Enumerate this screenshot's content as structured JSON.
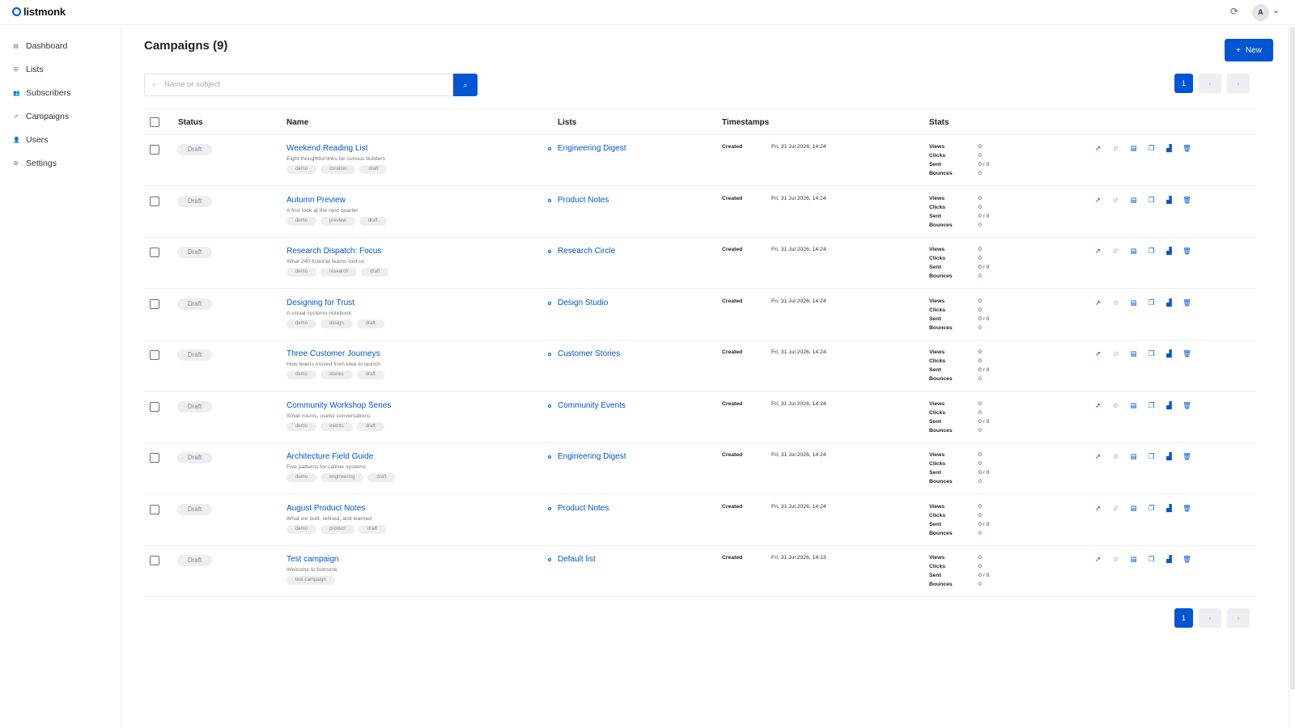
{
  "app": {
    "name": "listmonk"
  },
  "topbar": {
    "refresh_icon": "refresh-icon",
    "avatar_initial": "A"
  },
  "nav": [
    {
      "label": "Dashboard",
      "icon": "dashboard-icon"
    },
    {
      "label": "Lists",
      "icon": "lists-icon"
    },
    {
      "label": "Subscribers",
      "icon": "subscribers-icon"
    },
    {
      "label": "Campaigns",
      "icon": "rocket-icon"
    },
    {
      "label": "Users",
      "icon": "users-icon"
    },
    {
      "label": "Settings",
      "icon": "gear-icon"
    }
  ],
  "page": {
    "title": "Campaigns (9)",
    "new_label": "New"
  },
  "search": {
    "placeholder": "Name or subject"
  },
  "pagination": {
    "current": "1"
  },
  "table": {
    "headers": {
      "status": "Status",
      "name": "Name",
      "lists": "Lists",
      "timestamps": "Timestamps",
      "stats": "Stats"
    },
    "stat_labels": {
      "views": "Views",
      "clicks": "Clicks",
      "sent": "Sent",
      "bounces": "Bounces"
    },
    "created_label": "Created",
    "rows": [
      {
        "status": "Draft",
        "name": "Weekend Reading List",
        "subject": "Eight thoughtful links for curious builders",
        "tags": [
          "demo",
          "curation",
          "draft"
        ],
        "list": "Engineering Digest",
        "created": "Fri, 31 Jul 2026, 14:24",
        "views": "0",
        "clicks": "0",
        "sent": "0 / 0",
        "bounces": "0"
      },
      {
        "status": "Draft",
        "name": "Autumn Preview",
        "subject": "A first look at the next quarter",
        "tags": [
          "demo",
          "preview",
          "draft"
        ],
        "list": "Product Notes",
        "created": "Fri, 31 Jul 2026, 14:24",
        "views": "0",
        "clicks": "0",
        "sent": "0 / 0",
        "bounces": "0"
      },
      {
        "status": "Draft",
        "name": "Research Dispatch: Focus",
        "subject": "What 240 fictional teams told us",
        "tags": [
          "demo",
          "research",
          "draft"
        ],
        "list": "Research Circle",
        "created": "Fri, 31 Jul 2026, 14:24",
        "views": "0",
        "clicks": "0",
        "sent": "0 / 0",
        "bounces": "0"
      },
      {
        "status": "Draft",
        "name": "Designing for Trust",
        "subject": "A visual systems notebook",
        "tags": [
          "demo",
          "design",
          "draft"
        ],
        "list": "Design Studio",
        "created": "Fri, 31 Jul 2026, 14:24",
        "views": "0",
        "clicks": "0",
        "sent": "0 / 0",
        "bounces": "0"
      },
      {
        "status": "Draft",
        "name": "Three Customer Journeys",
        "subject": "How teams moved from idea to launch",
        "tags": [
          "demo",
          "stories",
          "draft"
        ],
        "list": "Customer Stories",
        "created": "Fri, 31 Jul 2026, 14:24",
        "views": "0",
        "clicks": "0",
        "sent": "0 / 0",
        "bounces": "0"
      },
      {
        "status": "Draft",
        "name": "Community Workshop Series",
        "subject": "Small rooms, useful conversations",
        "tags": [
          "demo",
          "events",
          "draft"
        ],
        "list": "Community Events",
        "created": "Fri, 31 Jul 2026, 14:24",
        "views": "0",
        "clicks": "0",
        "sent": "0 / 0",
        "bounces": "0"
      },
      {
        "status": "Draft",
        "name": "Architecture Field Guide",
        "subject": "Five patterns for calmer systems",
        "tags": [
          "demo",
          "engineering",
          "draft"
        ],
        "list": "Engineering Digest",
        "created": "Fri, 31 Jul 2026, 14:24",
        "views": "0",
        "clicks": "0",
        "sent": "0 / 0",
        "bounces": "0"
      },
      {
        "status": "Draft",
        "name": "August Product Notes",
        "subject": "What we built, refined, and learned",
        "tags": [
          "demo",
          "product",
          "draft"
        ],
        "list": "Product Notes",
        "created": "Fri, 31 Jul 2026, 14:24",
        "views": "0",
        "clicks": "0",
        "sent": "0 / 0",
        "bounces": "0"
      },
      {
        "status": "Draft",
        "name": "Test campaign",
        "subject": "Welcome to listmonk",
        "tags": [
          "test-campaign"
        ],
        "list": "Default list",
        "created": "Fri, 31 Jul 2026, 14:13",
        "views": "0",
        "clicks": "0",
        "sent": "0 / 0",
        "bounces": "0"
      }
    ]
  },
  "row_actions": [
    {
      "name": "start-campaign-icon",
      "glyph": "➚"
    },
    {
      "name": "cancel-campaign-icon",
      "glyph": "⊘"
    },
    {
      "name": "preview-icon",
      "glyph": "▤"
    },
    {
      "name": "clone-icon",
      "glyph": "❐"
    },
    {
      "name": "analytics-icon",
      "glyph": "▟"
    },
    {
      "name": "delete-icon",
      "glyph": "🗑"
    }
  ],
  "colors": {
    "accent": "#0055d4",
    "muted": "#eceef1"
  }
}
